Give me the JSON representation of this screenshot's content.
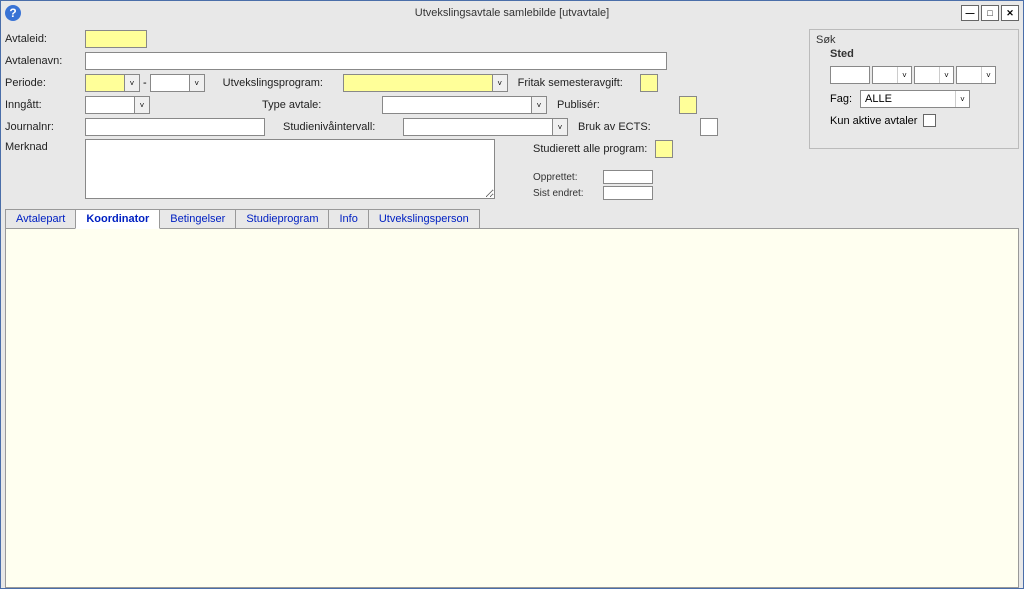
{
  "window": {
    "title": "Utvekslingsavtale samlebilde  [utvavtale]",
    "help_icon": "?"
  },
  "labels": {
    "avtaleid": "Avtaleid:",
    "avtalenavn": "Avtalenavn:",
    "periode": "Periode:",
    "inngatt": "Inngått:",
    "journalnr": "Journalnr:",
    "merknad": "Merknad",
    "utvekslingsprogram": "Utvekslingsprogram:",
    "type_avtale": "Type avtale:",
    "studienivaintervall": "Studienivåintervall:",
    "fritak": "Fritak semesteravgift:",
    "publiser": "Publisér:",
    "bruk_ects": "Bruk av ECTS:",
    "studierett": "Studierett alle program:",
    "opprettet": "Opprettet:",
    "sist_endret": "Sist endret:",
    "dash": "-"
  },
  "sok": {
    "title": "Søk",
    "sted": "Sted",
    "fag": "Fag:",
    "fag_value": "ALLE",
    "kun_aktive": "Kun aktive avtaler"
  },
  "tabs": {
    "avtalepart": "Avtalepart",
    "koordinator": "Koordinator",
    "betingelser": "Betingelser",
    "studieprogram": "Studieprogram",
    "info": "Info",
    "utvekslingsperson": "Utvekslingsperson"
  },
  "win_buttons": {
    "min": "—",
    "max": "□",
    "close": "✕"
  }
}
